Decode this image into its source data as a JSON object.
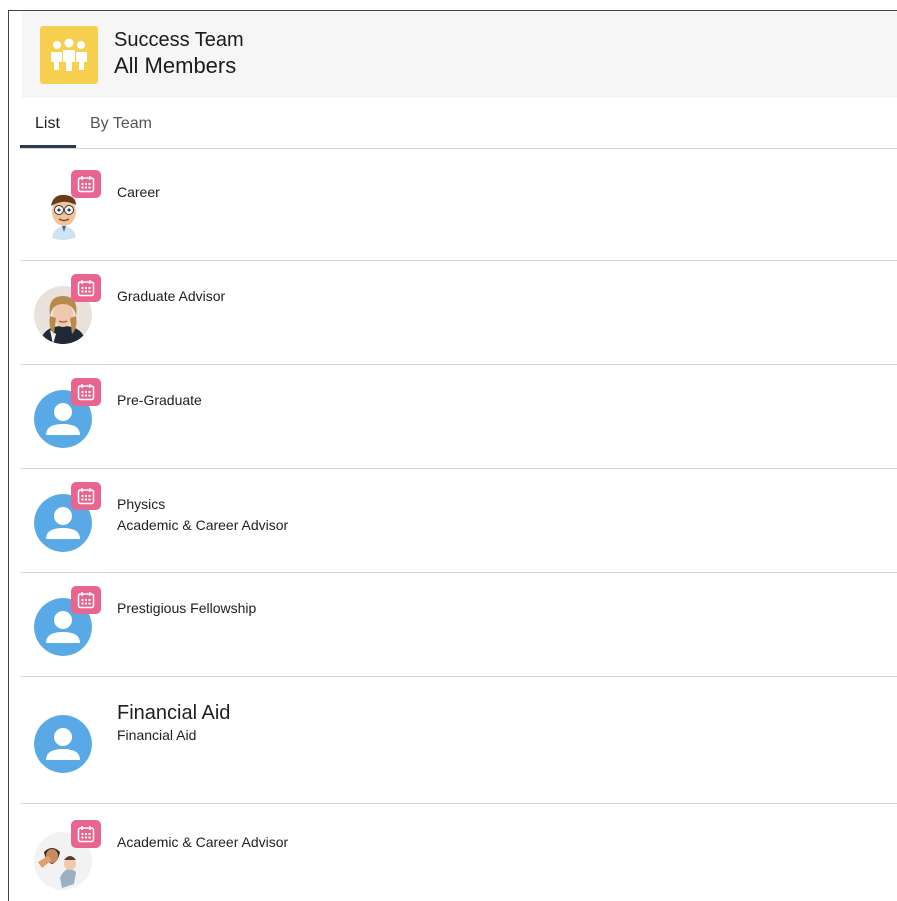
{
  "header": {
    "icon": "team-people-icon",
    "subtitle": "Success Team",
    "title": "All Members",
    "accent": "#f6cf4f"
  },
  "tabs": [
    {
      "label": "List",
      "active": true
    },
    {
      "label": "By Team",
      "active": false
    }
  ],
  "members": [
    {
      "avatar": "cartoon-man-avatar",
      "badge": "calendar-icon",
      "line1": "Career",
      "line2": ""
    },
    {
      "avatar": "woman-photo-avatar",
      "badge": "calendar-icon",
      "line1": "Graduate Advisor",
      "line2": ""
    },
    {
      "avatar": "default-user-avatar",
      "badge": "calendar-icon",
      "line1": "Pre-Graduate",
      "line2": ""
    },
    {
      "avatar": "default-user-avatar",
      "badge": "calendar-icon",
      "line1": "Physics",
      "line2": "Academic & Career Advisor"
    },
    {
      "avatar": "default-user-avatar",
      "badge": "calendar-icon",
      "line1": "Prestigious Fellowship",
      "line2": ""
    },
    {
      "avatar": "default-user-avatar",
      "badge": "",
      "name": "Financial Aid",
      "line1": "Financial Aid"
    },
    {
      "avatar": "people-photo-avatar",
      "badge": "calendar-icon",
      "line1": "Academic & Career Advisor",
      "line2": ""
    }
  ],
  "colors": {
    "avatar_blue": "#58a9e6",
    "badge_pink": "#e8658f",
    "tab_underline": "#2b3c52"
  }
}
